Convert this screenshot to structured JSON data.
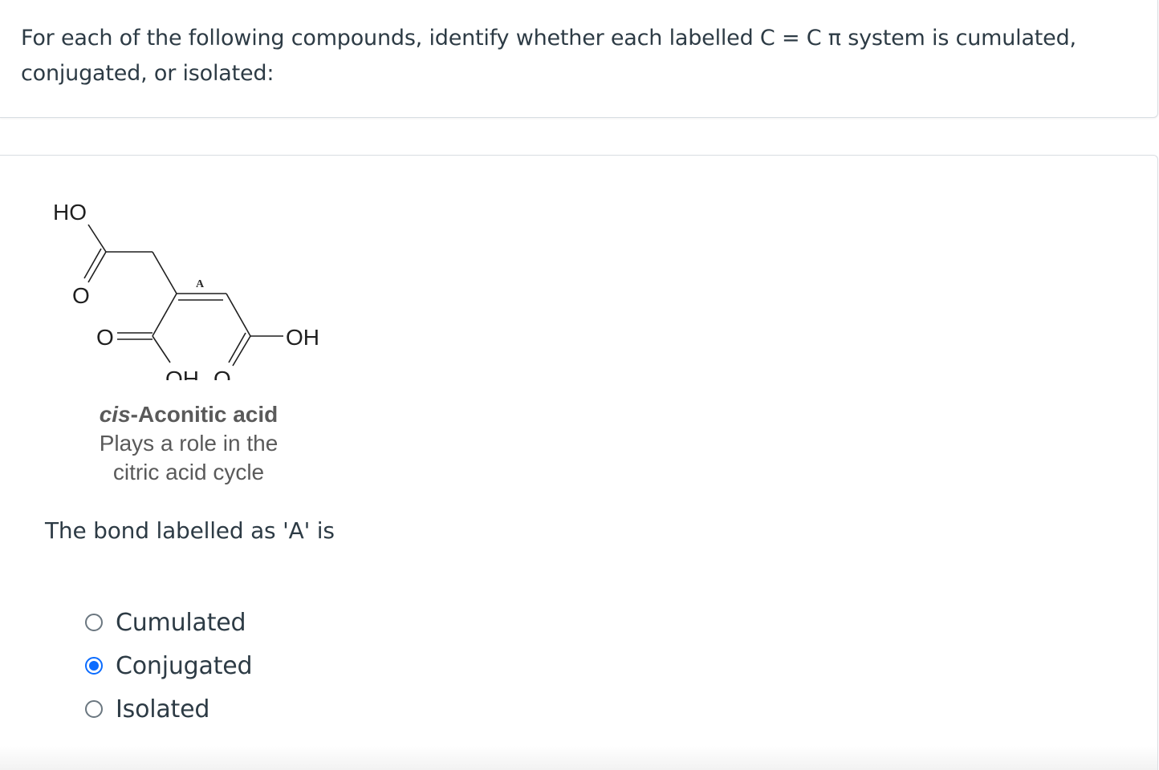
{
  "question": {
    "text": "For each of the following compounds, identify whether each labelled C = C π system is cumulated, conjugated, or isolated:"
  },
  "molecule": {
    "atoms": {
      "ho_top": "HO",
      "o_left": "O",
      "o_carbonyl_mid": "O",
      "oh_right": "OH",
      "oh_bottom": "OH",
      "o_bottom": "O"
    },
    "bond_label": "A",
    "caption": {
      "name_prefix": "cis",
      "name_rest": "-Aconitic acid",
      "line1": "Plays a role in the",
      "line2": "citric acid cycle"
    }
  },
  "prompt": "The bond labelled as 'A' is",
  "answers": [
    {
      "label": "Cumulated",
      "selected": false
    },
    {
      "label": "Conjugated",
      "selected": true
    },
    {
      "label": "Isolated",
      "selected": false
    }
  ],
  "colors": {
    "text": "#2d3b45",
    "accent": "#0b6cff",
    "border": "#d8dde2"
  }
}
